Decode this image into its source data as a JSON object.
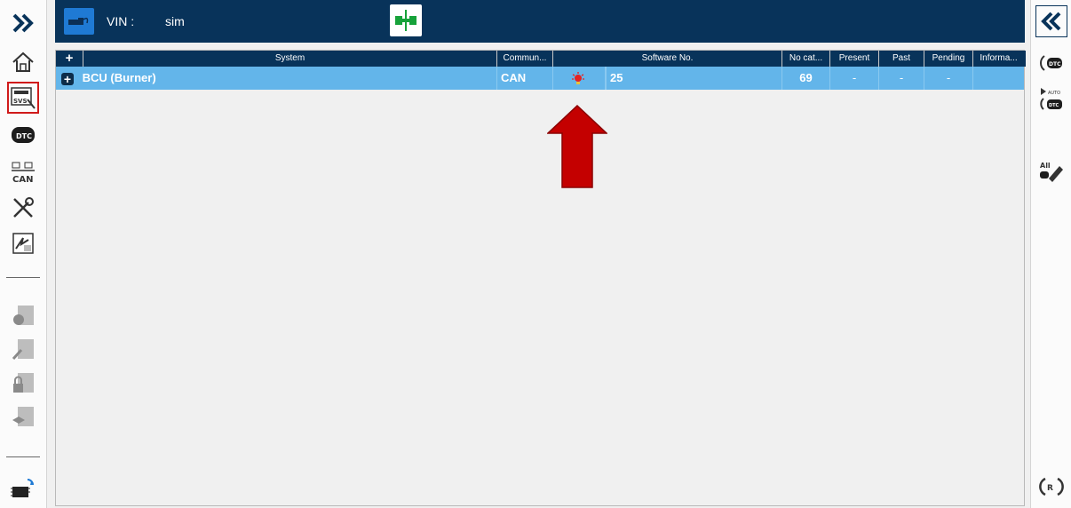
{
  "left_toolbar": {
    "items": [
      {
        "name": "expand-icon",
        "label": ""
      },
      {
        "name": "home-icon",
        "label": ""
      },
      {
        "name": "svs-icon",
        "label": "SVS"
      },
      {
        "name": "dtc-icon",
        "label": "DTC"
      },
      {
        "name": "can-icon",
        "label": "CAN"
      },
      {
        "name": "tools-icon",
        "label": ""
      },
      {
        "name": "flash-icon",
        "label": ""
      },
      {
        "name": "ecu-settings-icon",
        "label": ""
      },
      {
        "name": "ecu-edit-icon",
        "label": ""
      },
      {
        "name": "ecu-lock-icon",
        "label": ""
      },
      {
        "name": "ecu-learn-icon",
        "label": ""
      },
      {
        "name": "ecu-update-icon",
        "label": ""
      }
    ]
  },
  "right_toolbar": {
    "items": [
      {
        "name": "collapse-icon",
        "label": ""
      },
      {
        "name": "dtc-read-icon",
        "label": "DTC"
      },
      {
        "name": "auto-dtc-icon",
        "label": "AUTO DTC"
      },
      {
        "name": "clear-all-icon",
        "label": "All"
      },
      {
        "name": "refresh-icon",
        "label": ""
      }
    ]
  },
  "header": {
    "vin_label": "VIN :",
    "vin_value": "sim"
  },
  "table": {
    "expand_all": "+",
    "columns": [
      "System",
      "Commun...",
      "Software No.",
      "No cat...",
      "Present",
      "Past",
      "Pending",
      "Informa..."
    ],
    "rows": [
      {
        "system": "BCU (Burner)",
        "communication": "CAN",
        "software_no": "25",
        "no_cat": "69",
        "present": "-",
        "past": "-",
        "pending": "-",
        "information": ""
      }
    ]
  },
  "colors": {
    "header_bg": "#08335a",
    "row_selected": "#63b5ea",
    "arrow": "#c40000",
    "status_red": "#e62020"
  }
}
